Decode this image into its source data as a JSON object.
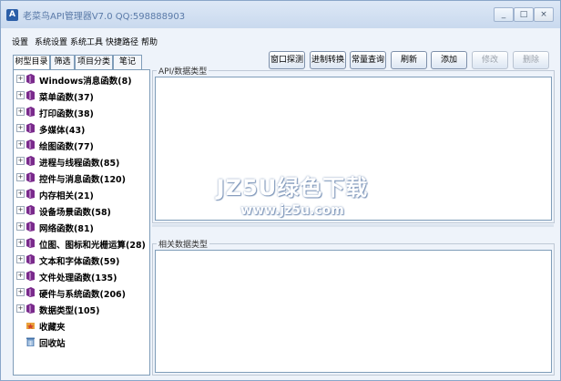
{
  "window": {
    "title": "老菜鸟API管理器V7.0   QQ:598888903",
    "app_icon_letter": "A",
    "controls": {
      "minimize": "_",
      "maximize": "□",
      "close": "×"
    }
  },
  "menu": [
    "设置",
    "系统设置",
    "系统工具",
    "快捷路径",
    "帮助"
  ],
  "tabs": [
    "树型目录",
    "筛选",
    "项目分类",
    "笔记"
  ],
  "toolbar": {
    "window_probe": "窗口探测",
    "base_convert": "进制转换",
    "constant_query": "常量查询",
    "refresh": "刷新",
    "add": "添加",
    "modify": "修改",
    "delete": "删除"
  },
  "tree": [
    "Windows消息函数(8)",
    "菜单函数(37)",
    "打印函数(38)",
    "多媒体(43)",
    "绘图函数(77)",
    "进程与线程函数(85)",
    "控件与消息函数(120)",
    "内存相关(21)",
    "设备场景函数(58)",
    "网络函数(81)",
    "位图、图标和光栅运算(28)",
    "文本和字体函数(59)",
    "文件处理函数(135)",
    "硬件与系统函数(206)",
    "数据类型(105)"
  ],
  "tree_special": {
    "favorites": "收藏夹",
    "recycle": "回收站"
  },
  "groups": {
    "api_types": "API/数据类型",
    "related_types": "相关数据类型"
  },
  "watermark": {
    "line1": "JZ5U绿色下载",
    "line2": "www.jz5u.com"
  },
  "colors": {
    "book": "#7a2a8c",
    "accent": "#2c5fa8"
  }
}
